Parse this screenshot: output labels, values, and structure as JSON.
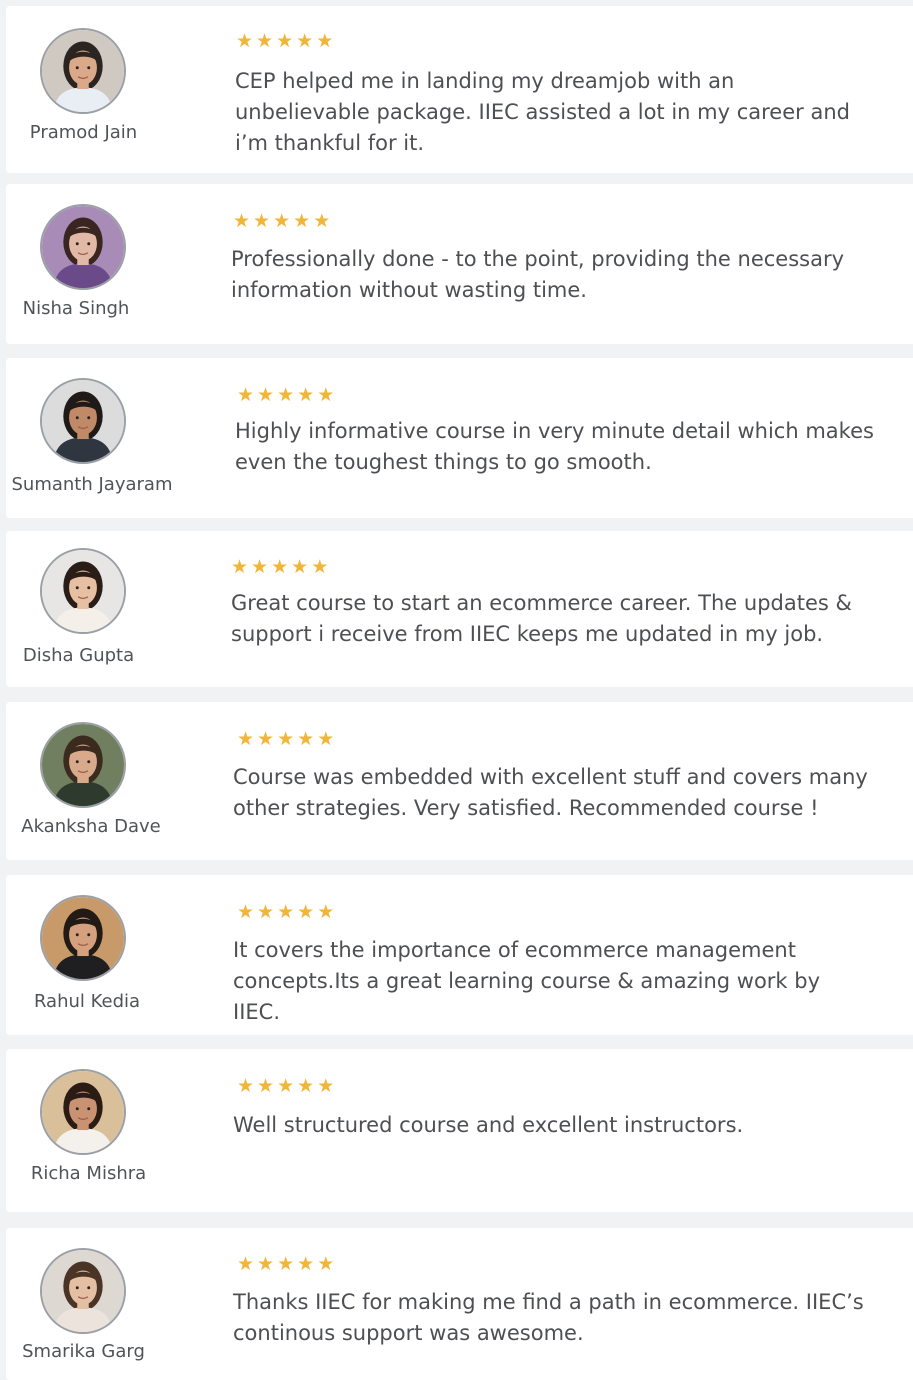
{
  "testimonials": [
    {
      "name": "Pramod Jain",
      "review": "CEP helped me in landing my dreamjob with an unbelievable package. IIEC assisted a lot in my career and i’m thankful for it.",
      "rating": 5,
      "skin": "#d9a98a",
      "hair": "#2b2420",
      "shirt": "#e8eef4",
      "bg": "#cfc9c2"
    },
    {
      "name": "Nisha Singh",
      "review": "Professionally done - to the point, providing the necessary information without wasting time.",
      "rating": 5,
      "skin": "#e2b9a6",
      "hair": "#3a2620",
      "shirt": "#6b4a8a",
      "bg": "#a98bb8"
    },
    {
      "name": "Sumanth Jayaram",
      "review": "Highly informative course in very minute detail which makes even the toughest things to go smooth.",
      "rating": 5,
      "skin": "#c08a68",
      "hair": "#1f1a17",
      "shirt": "#303640",
      "bg": "#dcdcdc"
    },
    {
      "name": "Disha Gupta",
      "review": "Great course to start an ecommerce career. The updates & support i receive from IIEC keeps me updated in my job.",
      "rating": 5,
      "skin": "#e7bfa2",
      "hair": "#2a1d17",
      "shirt": "#f4efe9",
      "bg": "#e7e6e4"
    },
    {
      "name": "Akanksha Dave",
      "review": "Course was embedded with excellent stuff and covers many other strategies. Very satisfied. Recommended course !",
      "rating": 5,
      "skin": "#d8a98a",
      "hair": "#3b2a1e",
      "shirt": "#2f3a2f",
      "bg": "#6f7f5f"
    },
    {
      "name": "Rahul Kedia",
      "review": "It covers the importance of ecommerce management concepts.Its a great learning course & amazing work by IIEC.",
      "rating": 5,
      "skin": "#d4a07e",
      "hair": "#221a15",
      "shirt": "#1f1f22",
      "bg": "#c89a6a"
    },
    {
      "name": "Richa Mishra",
      "review": "Well structured course and excellent instructors.",
      "rating": 5,
      "skin": "#c99373",
      "hair": "#2a1b14",
      "shirt": "#f4f1ec",
      "bg": "#d9c09a"
    },
    {
      "name": "Smarika Garg",
      "review": "Thanks IIEC for making me find a path in ecommerce. IIEC’s continous support was awesome.",
      "rating": 5,
      "skin": "#e4bfa4",
      "hair": "#4a3426",
      "shirt": "#ece4dc",
      "bg": "#ddd8d2"
    }
  ],
  "star_color": "#f0b63a",
  "star_glyph": "★",
  "icons": {
    "avatar": "person-photo-icon",
    "star": "star-icon"
  }
}
